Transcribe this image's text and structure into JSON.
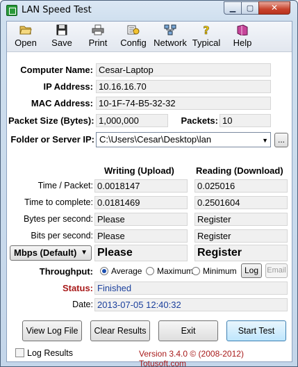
{
  "window": {
    "title": "LAN Speed Test",
    "min_glyph": "▁",
    "max_glyph": "▢",
    "close_glyph": "✕"
  },
  "toolbar": {
    "items": [
      {
        "label": "Open",
        "icon": "folder-open-icon"
      },
      {
        "label": "Save",
        "icon": "floppy-disk-icon"
      },
      {
        "label": "Print",
        "icon": "printer-icon"
      },
      {
        "label": "Config",
        "icon": "config-icon"
      },
      {
        "label": "Network",
        "icon": "network-icon"
      },
      {
        "label": "Typical",
        "icon": "help-question-icon"
      },
      {
        "label": "Help",
        "icon": "help-book-icon"
      }
    ]
  },
  "info": {
    "computer_name_label": "Computer Name:",
    "computer_name": "Cesar-Laptop",
    "ip_label": "IP Address:",
    "ip": "10.16.16.70",
    "mac_label": "MAC Address:",
    "mac": "10-1F-74-B5-32-32",
    "packet_size_label": "Packet Size (Bytes):",
    "packet_size": "1,000,000",
    "packets_label": "Packets:",
    "packets": "10",
    "folder_label": "Folder or Server IP:",
    "folder": "C:\\Users\\Cesar\\Desktop\\lan",
    "browse_label": "..."
  },
  "results": {
    "writing_header": "Writing (Upload)",
    "reading_header": "Reading (Download)",
    "rows": [
      {
        "label": "Time / Packet:",
        "write": "0.0018147",
        "read": "0.025016"
      },
      {
        "label": "Time to complete:",
        "write": "0.0181469",
        "read": "0.2501604"
      },
      {
        "label": "Bytes per second:",
        "write": "Please",
        "read": "Register"
      },
      {
        "label": "Bits per second:",
        "write": "Please",
        "read": "Register"
      }
    ],
    "unit_select": "Mbps (Default)",
    "big_write": "Please",
    "big_read": "Register"
  },
  "throughput": {
    "label": "Throughput:",
    "options": [
      "Average",
      "Maximum",
      "Minimum"
    ],
    "selected": "Average",
    "log_button": "Log",
    "email_button": "Email"
  },
  "status": {
    "label": "Status:",
    "value": "Finished",
    "date_label": "Date:",
    "date": "2013-07-05 12:40:32"
  },
  "actions": {
    "view_log": "View Log File",
    "clear": "Clear Results",
    "exit": "Exit",
    "start": "Start Test"
  },
  "footer": {
    "log_results": "Log Results",
    "version": "Version 3.4.0  © (2008-2012) Totusoft.com"
  },
  "colors": {
    "status_label": "#a81a1a",
    "value_blue": "#1a3f9c",
    "close_red": "#c8432c"
  }
}
